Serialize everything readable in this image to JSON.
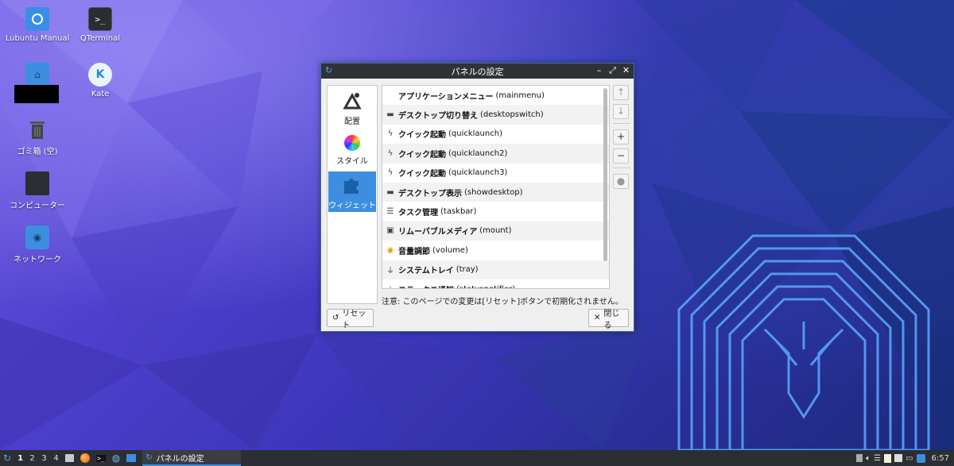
{
  "desktop": {
    "icons": [
      {
        "label": "Lubuntu Manual"
      },
      {
        "label": "QTerminal"
      },
      {
        "label": ""
      },
      {
        "label": "Kate"
      },
      {
        "label": "ゴミ箱 (空)"
      },
      {
        "label": "コンピューター"
      },
      {
        "label": "ネットワーク"
      }
    ]
  },
  "window": {
    "title": "パネルの設定",
    "controls": {
      "minimize": "–",
      "restore": "⤢",
      "close": "✕"
    },
    "sidebar": [
      {
        "label": "配置"
      },
      {
        "label": "スタイル"
      },
      {
        "label": "ウィジェット",
        "active": true
      }
    ],
    "widgets": [
      {
        "name": "アプリケーションメニュー",
        "id": "(mainmenu)",
        "icon": "blank-icon"
      },
      {
        "name": "デスクトップ切り替え",
        "id": "(desktopswitch)",
        "icon": "desktop-icon"
      },
      {
        "name": "クイック起動",
        "id": "(quicklaunch)",
        "icon": "lightning-icon"
      },
      {
        "name": "クイック起動",
        "id": "(quicklaunch2)",
        "icon": "lightning-icon"
      },
      {
        "name": "クイック起動",
        "id": "(quicklaunch3)",
        "icon": "lightning-icon"
      },
      {
        "name": "デスクトップ表示",
        "id": "(showdesktop)",
        "icon": "desktop-icon"
      },
      {
        "name": "タスク管理",
        "id": "(taskbar)",
        "icon": "taskbar-icon"
      },
      {
        "name": "リムーバブルメディア",
        "id": "(mount)",
        "icon": "media-icon"
      },
      {
        "name": "音量調節",
        "id": "(volume)",
        "icon": "volume-icon"
      },
      {
        "name": "システムトレイ",
        "id": "(tray)",
        "icon": "usb-icon"
      },
      {
        "name": "ステータス通知",
        "id": "(statusnotifier)",
        "icon": "usb-icon"
      }
    ],
    "side_buttons": {
      "up": "↑",
      "down": "↓",
      "add": "+",
      "remove": "−",
      "config": "●"
    },
    "note": "注意: このページでの変更は[リセット]ボタンで初期化されません。",
    "reset_label": "リセット",
    "close_label": "閉じる"
  },
  "taskbar": {
    "desktops": [
      "1",
      "2",
      "3",
      "4"
    ],
    "active_desktop": "1",
    "task_title": "パネルの設定",
    "clock": "6:57"
  }
}
